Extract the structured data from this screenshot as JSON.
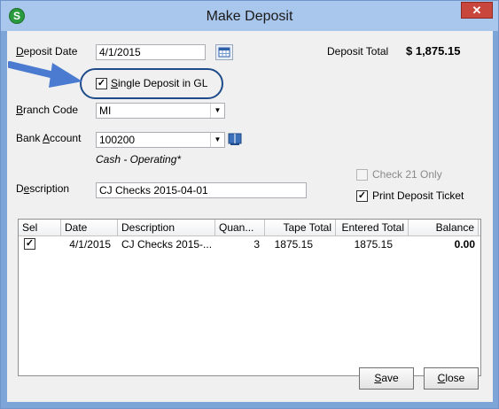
{
  "window": {
    "title": "Make Deposit",
    "close_label": "✕",
    "app_icon_letter": "S"
  },
  "form": {
    "deposit_date_label_u": "D",
    "deposit_date_label_rest": "eposit Date",
    "deposit_date_value": "4/1/2015",
    "single_deposit_u": "S",
    "single_deposit_rest": "ingle Deposit in GL",
    "single_deposit_checked": true,
    "branch_label_u": "B",
    "branch_label_rest": "ranch Code",
    "branch_value": "MI",
    "bank_label_pre": "Bank ",
    "bank_label_u": "A",
    "bank_label_rest": "ccount",
    "bank_value": "100200",
    "bank_account_name": "Cash - Operating*",
    "description_label_pre": "D",
    "description_label_u": "e",
    "description_label_rest": "scription",
    "description_value": "CJ Checks 2015-04-01",
    "deposit_total_label": "Deposit Total",
    "deposit_total_value": "$ 1,875.15",
    "check21_label": "Check 21 Only",
    "check21_checked": false,
    "print_ticket_label": "Print Deposit Ticket",
    "print_ticket_checked": true
  },
  "grid": {
    "columns": [
      "Sel",
      "Date",
      "Description",
      "Quan...",
      "Tape Total",
      "Entered Total",
      "Balance"
    ],
    "rows": [
      {
        "sel": true,
        "date": "4/1/2015",
        "description": "CJ Checks 2015-...",
        "quantity": "3",
        "tape_total": "1875.15",
        "entered_total": "1875.15",
        "balance": "0.00"
      }
    ]
  },
  "buttons": {
    "save_u": "S",
    "save_rest": "ave",
    "close_u": "C",
    "close_rest": "lose"
  },
  "icons": {
    "calendar": "calendar-icon",
    "lookup": "book-icon",
    "arrow": "pointer-arrow-icon"
  },
  "colors": {
    "title_bar": "#a9c6ec",
    "window_border": "#7ea5d8",
    "arrow": "#4a7bd0",
    "highlight_ring": "#1e4b8a"
  }
}
